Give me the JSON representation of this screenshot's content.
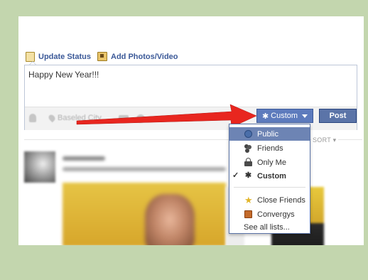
{
  "composer": {
    "update_status_label": "Update Status",
    "add_photos_label": "Add Photos/Video",
    "status_text": "Happy New Year!!!",
    "place_label": "Baseled City",
    "custom_label": "Custom",
    "post_label": "Post"
  },
  "feed": {
    "sort_label": "SORT ▾"
  },
  "audience_menu": {
    "items": [
      {
        "label": "Public",
        "icon": "globe-icon",
        "selected": true
      },
      {
        "label": "Friends",
        "icon": "friends-icon"
      },
      {
        "label": "Only Me",
        "icon": "lock-icon"
      },
      {
        "label": "Custom",
        "icon": "gear-icon",
        "checked": true
      },
      {
        "label": "Close Friends",
        "icon": "star-icon"
      },
      {
        "label": "Convergys",
        "icon": "work-icon"
      },
      {
        "label": "See all lists...",
        "icon": ""
      }
    ]
  },
  "colors": {
    "background": "#c3d6ae",
    "facebook_blue": "#3b5998",
    "selection": "#6d84b4",
    "arrow": "#e8261f"
  }
}
